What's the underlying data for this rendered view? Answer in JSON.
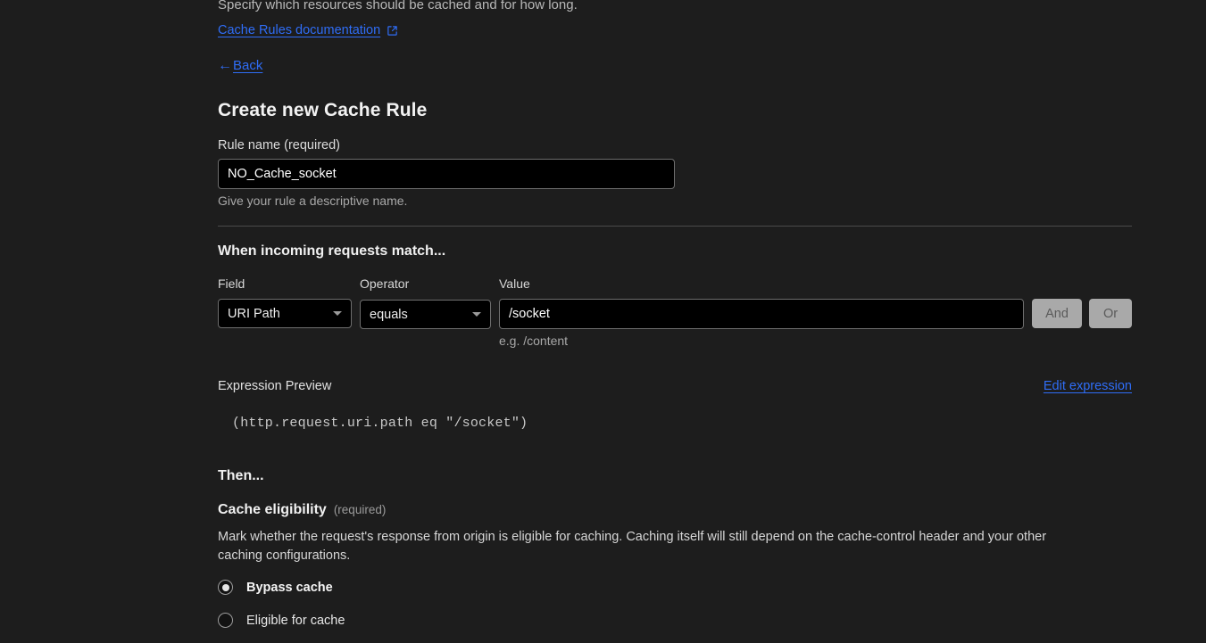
{
  "intro": {
    "description": "Specify which resources should be cached and for how long.",
    "doc_link": "Cache Rules documentation",
    "doc_link_icon": "external-link-icon",
    "back_arrow": "←",
    "back_label": "Back"
  },
  "page_title": "Create new Cache Rule",
  "rule_name": {
    "label": "Rule name (required)",
    "value": "NO_Cache_socket",
    "placeholder": "",
    "help": "Give your rule a descriptive name."
  },
  "when_section": {
    "heading": "When incoming requests match...",
    "field_label": "Field",
    "operator_label": "Operator",
    "value_label": "Value",
    "field_value": "URI Path",
    "operator_value": "equals",
    "value_value": "/socket",
    "value_placeholder": "",
    "value_help": "e.g. /content",
    "and_button": "And",
    "or_button": "Or"
  },
  "expression": {
    "label": "Expression Preview",
    "edit_link": "Edit expression",
    "code": "(http.request.uri.path eq \"/socket\")"
  },
  "then_section": {
    "heading": "Then...",
    "cache_eligibility_title": "Cache eligibility",
    "cache_eligibility_required": "(required)",
    "description": "Mark whether the request's response from origin is eligible for caching. Caching itself will still depend on the cache-control header and your other caching configurations.",
    "options": [
      {
        "label": "Bypass cache",
        "selected": true
      },
      {
        "label": "Eligible for cache",
        "selected": false
      }
    ]
  },
  "colors": {
    "background": "#1d1d1d",
    "input_background": "#000000",
    "link": "#2f6df6",
    "border": "#6e6e6e",
    "button_disabled": "#a9a9a9"
  }
}
